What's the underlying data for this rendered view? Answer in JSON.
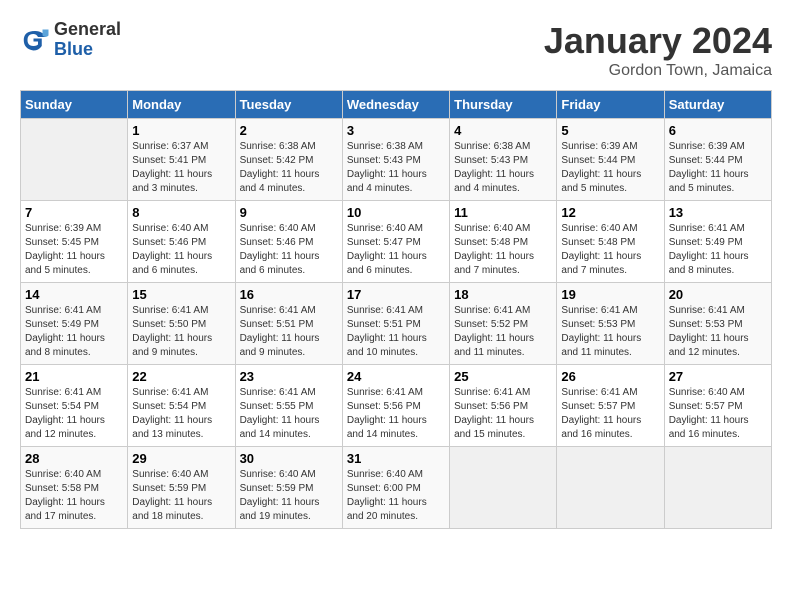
{
  "header": {
    "logo_general": "General",
    "logo_blue": "Blue",
    "month_title": "January 2024",
    "location": "Gordon Town, Jamaica"
  },
  "days_of_week": [
    "Sunday",
    "Monday",
    "Tuesday",
    "Wednesday",
    "Thursday",
    "Friday",
    "Saturday"
  ],
  "weeks": [
    [
      {
        "day": "",
        "sunrise": "",
        "sunset": "",
        "daylight": ""
      },
      {
        "day": "1",
        "sunrise": "Sunrise: 6:37 AM",
        "sunset": "Sunset: 5:41 PM",
        "daylight": "Daylight: 11 hours and 3 minutes."
      },
      {
        "day": "2",
        "sunrise": "Sunrise: 6:38 AM",
        "sunset": "Sunset: 5:42 PM",
        "daylight": "Daylight: 11 hours and 4 minutes."
      },
      {
        "day": "3",
        "sunrise": "Sunrise: 6:38 AM",
        "sunset": "Sunset: 5:43 PM",
        "daylight": "Daylight: 11 hours and 4 minutes."
      },
      {
        "day": "4",
        "sunrise": "Sunrise: 6:38 AM",
        "sunset": "Sunset: 5:43 PM",
        "daylight": "Daylight: 11 hours and 4 minutes."
      },
      {
        "day": "5",
        "sunrise": "Sunrise: 6:39 AM",
        "sunset": "Sunset: 5:44 PM",
        "daylight": "Daylight: 11 hours and 5 minutes."
      },
      {
        "day": "6",
        "sunrise": "Sunrise: 6:39 AM",
        "sunset": "Sunset: 5:44 PM",
        "daylight": "Daylight: 11 hours and 5 minutes."
      }
    ],
    [
      {
        "day": "7",
        "sunrise": "Sunrise: 6:39 AM",
        "sunset": "Sunset: 5:45 PM",
        "daylight": "Daylight: 11 hours and 5 minutes."
      },
      {
        "day": "8",
        "sunrise": "Sunrise: 6:40 AM",
        "sunset": "Sunset: 5:46 PM",
        "daylight": "Daylight: 11 hours and 6 minutes."
      },
      {
        "day": "9",
        "sunrise": "Sunrise: 6:40 AM",
        "sunset": "Sunset: 5:46 PM",
        "daylight": "Daylight: 11 hours and 6 minutes."
      },
      {
        "day": "10",
        "sunrise": "Sunrise: 6:40 AM",
        "sunset": "Sunset: 5:47 PM",
        "daylight": "Daylight: 11 hours and 6 minutes."
      },
      {
        "day": "11",
        "sunrise": "Sunrise: 6:40 AM",
        "sunset": "Sunset: 5:48 PM",
        "daylight": "Daylight: 11 hours and 7 minutes."
      },
      {
        "day": "12",
        "sunrise": "Sunrise: 6:40 AM",
        "sunset": "Sunset: 5:48 PM",
        "daylight": "Daylight: 11 hours and 7 minutes."
      },
      {
        "day": "13",
        "sunrise": "Sunrise: 6:41 AM",
        "sunset": "Sunset: 5:49 PM",
        "daylight": "Daylight: 11 hours and 8 minutes."
      }
    ],
    [
      {
        "day": "14",
        "sunrise": "Sunrise: 6:41 AM",
        "sunset": "Sunset: 5:49 PM",
        "daylight": "Daylight: 11 hours and 8 minutes."
      },
      {
        "day": "15",
        "sunrise": "Sunrise: 6:41 AM",
        "sunset": "Sunset: 5:50 PM",
        "daylight": "Daylight: 11 hours and 9 minutes."
      },
      {
        "day": "16",
        "sunrise": "Sunrise: 6:41 AM",
        "sunset": "Sunset: 5:51 PM",
        "daylight": "Daylight: 11 hours and 9 minutes."
      },
      {
        "day": "17",
        "sunrise": "Sunrise: 6:41 AM",
        "sunset": "Sunset: 5:51 PM",
        "daylight": "Daylight: 11 hours and 10 minutes."
      },
      {
        "day": "18",
        "sunrise": "Sunrise: 6:41 AM",
        "sunset": "Sunset: 5:52 PM",
        "daylight": "Daylight: 11 hours and 11 minutes."
      },
      {
        "day": "19",
        "sunrise": "Sunrise: 6:41 AM",
        "sunset": "Sunset: 5:53 PM",
        "daylight": "Daylight: 11 hours and 11 minutes."
      },
      {
        "day": "20",
        "sunrise": "Sunrise: 6:41 AM",
        "sunset": "Sunset: 5:53 PM",
        "daylight": "Daylight: 11 hours and 12 minutes."
      }
    ],
    [
      {
        "day": "21",
        "sunrise": "Sunrise: 6:41 AM",
        "sunset": "Sunset: 5:54 PM",
        "daylight": "Daylight: 11 hours and 12 minutes."
      },
      {
        "day": "22",
        "sunrise": "Sunrise: 6:41 AM",
        "sunset": "Sunset: 5:54 PM",
        "daylight": "Daylight: 11 hours and 13 minutes."
      },
      {
        "day": "23",
        "sunrise": "Sunrise: 6:41 AM",
        "sunset": "Sunset: 5:55 PM",
        "daylight": "Daylight: 11 hours and 14 minutes."
      },
      {
        "day": "24",
        "sunrise": "Sunrise: 6:41 AM",
        "sunset": "Sunset: 5:56 PM",
        "daylight": "Daylight: 11 hours and 14 minutes."
      },
      {
        "day": "25",
        "sunrise": "Sunrise: 6:41 AM",
        "sunset": "Sunset: 5:56 PM",
        "daylight": "Daylight: 11 hours and 15 minutes."
      },
      {
        "day": "26",
        "sunrise": "Sunrise: 6:41 AM",
        "sunset": "Sunset: 5:57 PM",
        "daylight": "Daylight: 11 hours and 16 minutes."
      },
      {
        "day": "27",
        "sunrise": "Sunrise: 6:40 AM",
        "sunset": "Sunset: 5:57 PM",
        "daylight": "Daylight: 11 hours and 16 minutes."
      }
    ],
    [
      {
        "day": "28",
        "sunrise": "Sunrise: 6:40 AM",
        "sunset": "Sunset: 5:58 PM",
        "daylight": "Daylight: 11 hours and 17 minutes."
      },
      {
        "day": "29",
        "sunrise": "Sunrise: 6:40 AM",
        "sunset": "Sunset: 5:59 PM",
        "daylight": "Daylight: 11 hours and 18 minutes."
      },
      {
        "day": "30",
        "sunrise": "Sunrise: 6:40 AM",
        "sunset": "Sunset: 5:59 PM",
        "daylight": "Daylight: 11 hours and 19 minutes."
      },
      {
        "day": "31",
        "sunrise": "Sunrise: 6:40 AM",
        "sunset": "Sunset: 6:00 PM",
        "daylight": "Daylight: 11 hours and 20 minutes."
      },
      {
        "day": "",
        "sunrise": "",
        "sunset": "",
        "daylight": ""
      },
      {
        "day": "",
        "sunrise": "",
        "sunset": "",
        "daylight": ""
      },
      {
        "day": "",
        "sunrise": "",
        "sunset": "",
        "daylight": ""
      }
    ]
  ]
}
